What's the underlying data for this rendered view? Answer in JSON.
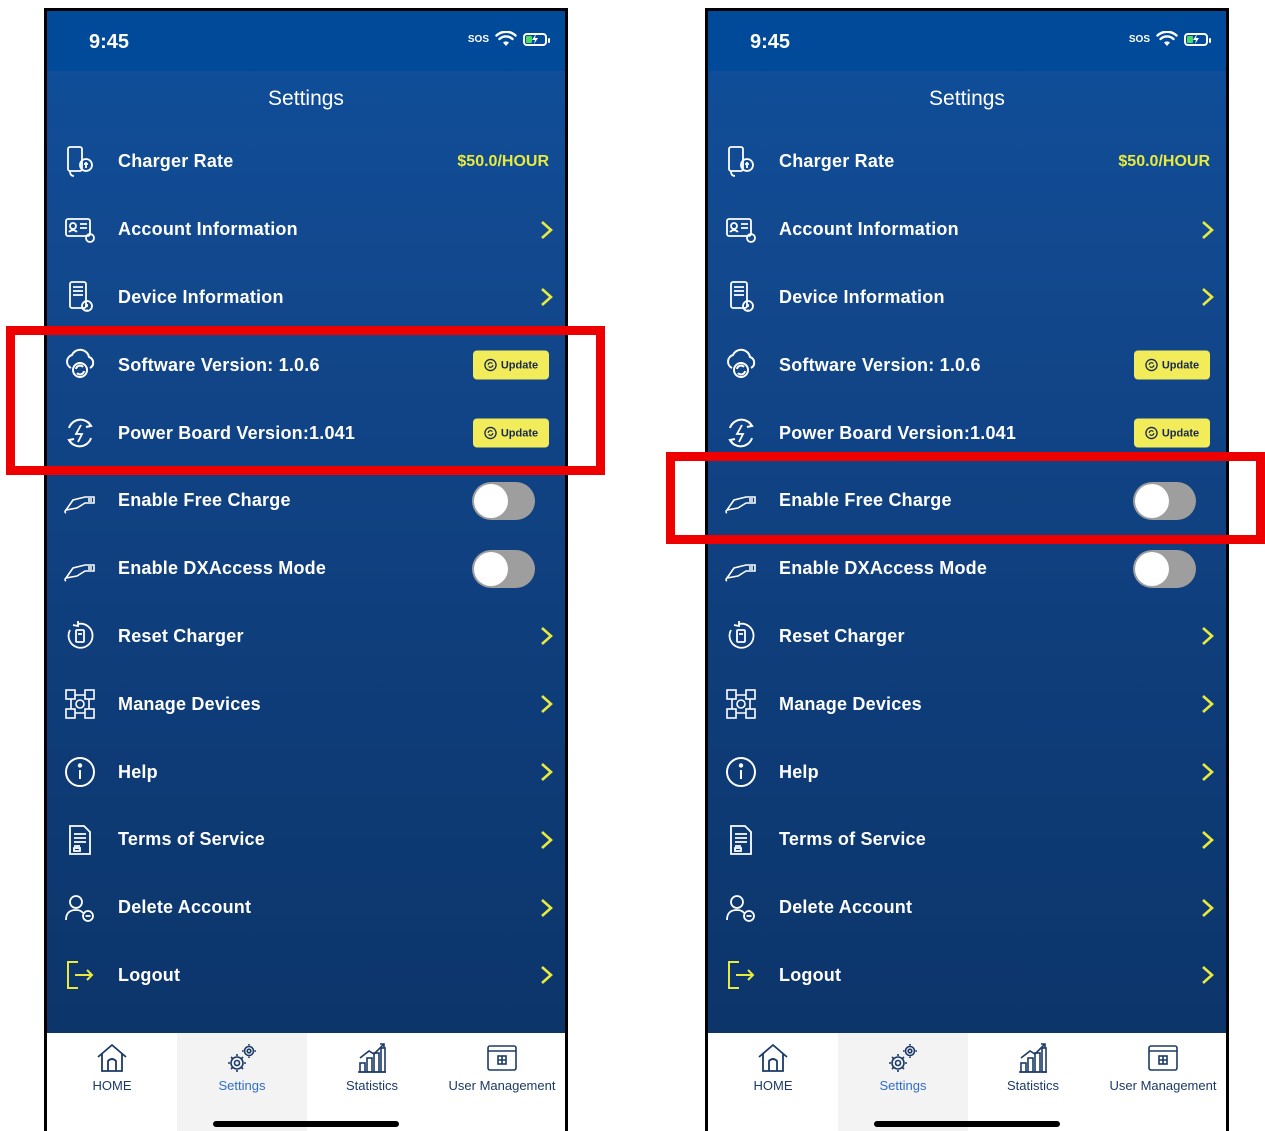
{
  "screens": [
    {
      "status": {
        "time": "9:45",
        "sos": "SOS"
      },
      "title": "Settings",
      "rows": {
        "charger_rate": {
          "label": "Charger Rate",
          "value": "$50.0/HOUR"
        },
        "account_information": {
          "label": "Account Information"
        },
        "device_information": {
          "label": "Device Information"
        },
        "software_version": {
          "label": "Software Version: 1.0.6",
          "button": "Update"
        },
        "power_board_version": {
          "label": "Power Board Version:1.041",
          "button": "Update"
        },
        "enable_free_charge": {
          "label": "Enable Free Charge",
          "enabled": false
        },
        "enable_dxaccess_mode": {
          "label": "Enable DXAccess Mode",
          "enabled": false
        },
        "reset_charger": {
          "label": "Reset Charger"
        },
        "manage_devices": {
          "label": "Manage Devices"
        },
        "help": {
          "label": "Help"
        },
        "terms_of_service": {
          "label": "Terms of Service"
        },
        "delete_account": {
          "label": "Delete Account"
        },
        "logout": {
          "label": "Logout"
        }
      },
      "tabs": {
        "home": "HOME",
        "settings": "Settings",
        "statistics": "Statistics",
        "user_management": "User Management"
      },
      "active_tab": "Settings",
      "highlighted_rows": [
        "Software Version: 1.0.6",
        "Power Board Version:1.041"
      ]
    },
    {
      "status": {
        "time": "9:45",
        "sos": "SOS"
      },
      "title": "Settings",
      "rows": {
        "charger_rate": {
          "label": "Charger Rate",
          "value": "$50.0/HOUR"
        },
        "account_information": {
          "label": "Account Information"
        },
        "device_information": {
          "label": "Device Information"
        },
        "software_version": {
          "label": "Software Version: 1.0.6",
          "button": "Update"
        },
        "power_board_version": {
          "label": "Power Board Version:1.041",
          "button": "Update"
        },
        "enable_free_charge": {
          "label": "Enable Free Charge",
          "enabled": false
        },
        "enable_dxaccess_mode": {
          "label": "Enable DXAccess Mode",
          "enabled": false
        },
        "reset_charger": {
          "label": "Reset Charger"
        },
        "manage_devices": {
          "label": "Manage Devices"
        },
        "help": {
          "label": "Help"
        },
        "terms_of_service": {
          "label": "Terms of Service"
        },
        "delete_account": {
          "label": "Delete Account"
        },
        "logout": {
          "label": "Logout"
        }
      },
      "tabs": {
        "home": "HOME",
        "settings": "Settings",
        "statistics": "Statistics",
        "user_management": "User Management"
      },
      "active_tab": "Settings",
      "highlighted_rows": [
        "Enable Free Charge"
      ]
    }
  ],
  "colors": {
    "background": "#0f4a90",
    "accent_yellow": "#f2ec5a",
    "rate_text": "#e8ea3e",
    "highlight_red": "#ee0000",
    "active_tab": "#2f6fc9"
  },
  "icons": [
    "charger-rate-icon",
    "id-card-icon",
    "device-icon",
    "cloud-sync-icon",
    "power-sync-icon",
    "charger-plug-icon",
    "reset-icon",
    "network-icon",
    "info-icon",
    "document-icon",
    "user-remove-icon",
    "logout-icon",
    "chevron-right-icon",
    "home-icon",
    "gears-icon",
    "chart-icon",
    "window-icon"
  ]
}
